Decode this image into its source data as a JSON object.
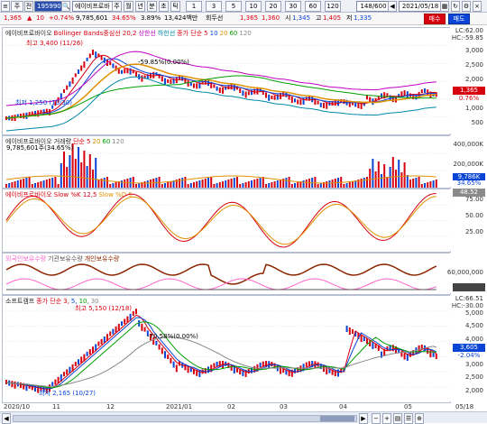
{
  "toolbar": {
    "code_label": "주",
    "code_arrow": "▾",
    "market": "전",
    "code_value": "195990",
    "stock_name": "에이비프로바",
    "period_buttons": [
      "주",
      "월",
      "년",
      "분",
      "초",
      "틱"
    ],
    "interval_buttons": [
      "1",
      "3",
      "5",
      "10",
      "20",
      "30",
      "60",
      "120"
    ],
    "count_value": "148/600",
    "date_value": "2021/05/18"
  },
  "quote": {
    "price": "1,365",
    "change_arrow": "▲",
    "change": "10",
    "change_pct": "+0.74%",
    "volume": "9,785,601",
    "turnover_pct": "34.65%",
    "rate": "3.89%",
    "amount": "13,424백만",
    "rotation": "회두선",
    "open": "1,365",
    "high": "1,360",
    "label_si": "시",
    "low": "1,345",
    "label_go": "고",
    "close1": "1,405",
    "label_jeo": "저",
    "close2": "1,335",
    "buy_label": "매수",
    "sell_label": "매도"
  },
  "panes": {
    "price": {
      "legend": [
        {
          "text": "에이비프로바이오",
          "color": "#222222"
        },
        {
          "text": "Bollinger Bands중심선 20,2",
          "color": "#d7000f"
        },
        {
          "text": "상한선",
          "color": "#c000c0"
        },
        {
          "text": "하한선",
          "color": "#0088aa"
        },
        {
          "text": "종가 단순",
          "color": "#d7000f"
        },
        {
          "text": "5",
          "color": "#d7000f"
        },
        {
          "text": "10",
          "color": "#0a45d6"
        },
        {
          "text": "20",
          "color": "#e09000"
        },
        {
          "text": "60",
          "color": "#00a000"
        },
        {
          "text": "120",
          "color": "#888888"
        }
      ],
      "high_annotation": "최고 3,400 (11/26)",
      "low_annotation": "최저 1,250 (10/30)",
      "mid_annotation": "-59.85%(0.00%)",
      "axis_top": "LC:62.00",
      "axis_top2": "HC:-59.85",
      "ticks": [
        "3,000",
        "2,500",
        "2,000",
        "1,500",
        "1,000",
        "500"
      ],
      "price_box": "1,365",
      "price_box_pct": "0.76%"
    },
    "volume": {
      "legend": [
        {
          "text": "에이비프로바이오 거래량",
          "color": "#222222"
        },
        {
          "text": "단순",
          "color": "#d7000f"
        },
        {
          "text": "5",
          "color": "#d7000f"
        },
        {
          "text": "20",
          "color": "#e09000"
        },
        {
          "text": "60",
          "color": "#00a000"
        },
        {
          "text": "120",
          "color": "#888888"
        }
      ],
      "annotation": "9,785,601주(34.65%)",
      "ticks": [
        "400,000K",
        "200,000K"
      ],
      "box": "9,786K",
      "box2": "34.65%"
    },
    "slow": {
      "legend": [
        {
          "text": "에이비프로바이오 Slow %K 12,5",
          "color": "#d7000f"
        },
        {
          "text": "Slow %D 5",
          "color": "#e09000"
        }
      ],
      "ticks": [
        "75.00",
        "50.00",
        "25.00"
      ],
      "box": "48.52"
    },
    "holdings": {
      "legend": [
        {
          "text": "외국인보유수량",
          "color": "#ff66cc"
        },
        {
          "text": "기관보유수량",
          "color": "#555555"
        },
        {
          "text": "개인보유수량",
          "color": "#8b2500"
        }
      ],
      "ticks": [
        "60,000,000"
      ],
      "box": "",
      "box_color": "#444444"
    },
    "compare": {
      "legend": [
        {
          "text": "소프트캠프",
          "color": "#222222"
        },
        {
          "text": "종가 단순",
          "color": "#d7000f"
        },
        {
          "text": "3,",
          "color": "#d7000f"
        },
        {
          "text": "5,",
          "color": "#0a45d6"
        },
        {
          "text": "10,",
          "color": "#00a000"
        },
        {
          "text": "30",
          "color": "#888888"
        }
      ],
      "high_annotation": "최고 5,150 (12/18)",
      "low_annotation": "최저 2,165 (10/27)",
      "mid_annotation": "-70.58%(0.00%)",
      "axis_top": "LC:66.51",
      "axis_top2": "HC:-30.00",
      "ticks": [
        "5,000",
        "4,500",
        "4,000",
        "3,500",
        "3,000",
        "2,500",
        "2,000"
      ],
      "price_box": "3,605",
      "price_box_pct": "-2.04%"
    }
  },
  "x_axis": [
    "2020/10",
    "11",
    "12",
    "2021/01",
    "02",
    "03",
    "04",
    "05",
    "05/18"
  ],
  "colors": {
    "up": "#d7000f",
    "down": "#0a45d6",
    "ma5": "#d7000f",
    "ma10": "#0a45d6",
    "ma20": "#e09000",
    "ma60": "#00a000",
    "ma120": "#888888",
    "bb_upper": "#c000c0",
    "bb_lower": "#0088aa"
  },
  "status": {
    "scroll_left": "◀",
    "scroll_right": "▶",
    "zoom_minus": "−",
    "zoom_plus": "+"
  }
}
